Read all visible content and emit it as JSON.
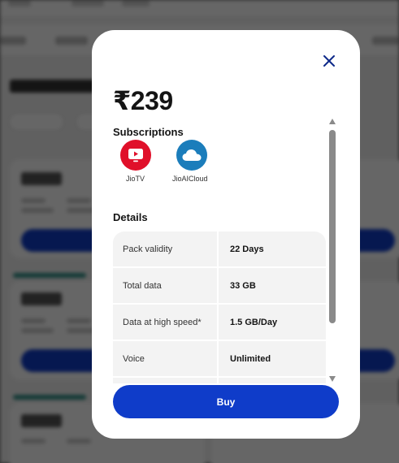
{
  "colors": {
    "accent": "#0f3cc9",
    "jiotv": "#e0102a",
    "jioaicloud": "#1b7dbb"
  },
  "plan": {
    "price": "₹239"
  },
  "subscriptions": {
    "title": "Subscriptions",
    "apps": [
      {
        "name": "JioTV",
        "icon": "tv-play-icon"
      },
      {
        "name": "JioAICloud",
        "icon": "cloud-icon"
      }
    ]
  },
  "details": {
    "title": "Details",
    "rows": [
      {
        "label": "Pack validity",
        "value": "22 Days"
      },
      {
        "label": "Total data",
        "value": "33 GB"
      },
      {
        "label": "Data at high speed*",
        "value": "1.5 GB/Day"
      },
      {
        "label": "Voice",
        "value": "Unlimited"
      },
      {
        "label": "",
        "value": ""
      }
    ]
  },
  "actions": {
    "buy_label": "Buy"
  }
}
